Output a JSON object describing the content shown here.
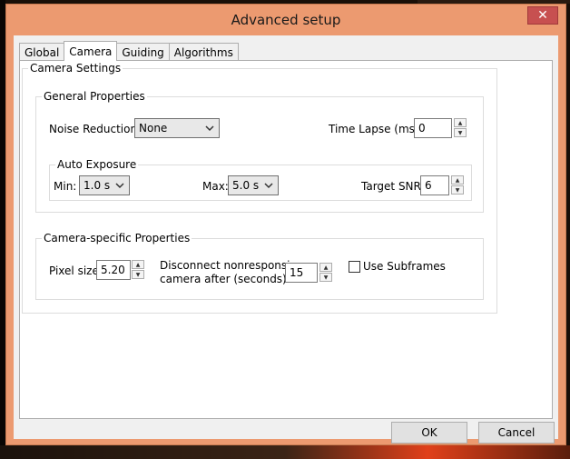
{
  "window": {
    "title": "Advanced setup",
    "close_glyph": "✕"
  },
  "tabs": [
    {
      "label": "Global"
    },
    {
      "label": "Camera",
      "active": true
    },
    {
      "label": "Guiding"
    },
    {
      "label": "Algorithms"
    }
  ],
  "camera_settings": {
    "label": "Camera Settings",
    "general": {
      "label": "General Properties",
      "noise_reduction_label": "Noise Reduction:",
      "noise_reduction_value": "None",
      "time_lapse_label": "Time Lapse (ms):",
      "time_lapse_value": "0",
      "auto_exposure": {
        "label": "Auto Exposure",
        "min_label": "Min:",
        "min_value": "1.0 s",
        "max_label": "Max:",
        "max_value": "5.0 s",
        "snr_label": "Target SNR:",
        "snr_value": "6"
      }
    },
    "specific": {
      "label": "Camera-specific Properties",
      "pixel_size_label": "Pixel size:",
      "pixel_size_value": "5.20",
      "disconnect_label_line1": "Disconnect nonresponsive",
      "disconnect_label_line2": "camera after (seconds):",
      "disconnect_value": "15",
      "subframes_label": "Use Subframes",
      "subframes_checked": false
    }
  },
  "buttons": {
    "ok": "OK",
    "cancel": "Cancel"
  }
}
